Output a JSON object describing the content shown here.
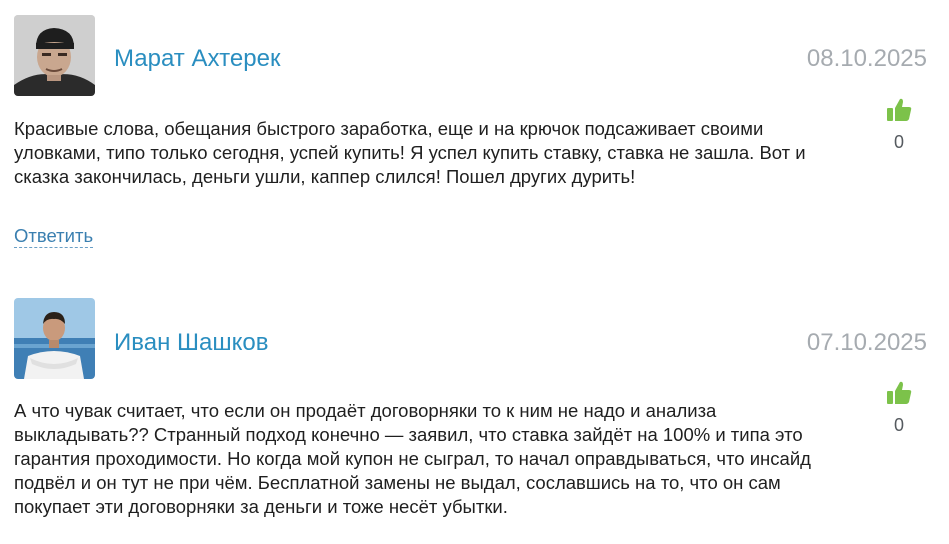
{
  "comments": [
    {
      "author": "Марат Ахтерек",
      "date": "08.10.2025",
      "text": "Красивые слова, обещания быстрого заработка, еще и на крючок подсаживает своими уловками, типо только сегодня, успей купить! Я успел купить ставку, ставка не зашла. Вот и сказка закончилась, деньги ушли, каппер слился! Пошел других дурить!",
      "likes": "0",
      "reply_label": "Ответить",
      "avatar_icon": "user-photo-dark-cap"
    },
    {
      "author": "Иван Шашков",
      "date": "07.10.2025",
      "text": "А что чувак считает, что если он продаёт договорняки то к ним не надо и анализа выкладывать?? Странный подход конечно — заявил, что ставка зайдёт на 100% и типа это гарантия проходимости. Но когда мой купон не сыграл, то начал оправдываться, что инсайд подвёл и он тут не при чём. Бесплатной замены не выдал, сославшись на то, что он сам покупает эти договорняки за деньги и тоже несёт убытки.",
      "likes": "0",
      "avatar_icon": "user-photo-seaside"
    }
  ],
  "colors": {
    "author": "#2a8ec0",
    "date": "#a6abb0",
    "like": "#7cc24a",
    "reply": "#3a7fb0"
  },
  "icons": {
    "like": "thumbs-up-icon"
  }
}
